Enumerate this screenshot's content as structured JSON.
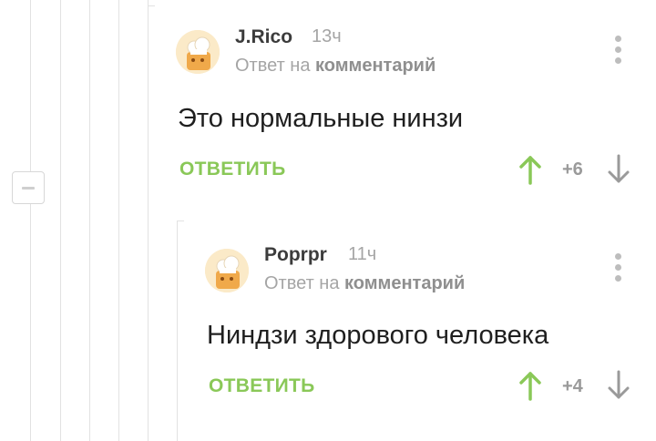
{
  "colors": {
    "accent": "#8ac858",
    "guide_line": "#e2e2e2",
    "muted_text": "#a5a5a5",
    "text": "#1f1f1f"
  },
  "thread": {
    "collapse_icon": "minus-icon"
  },
  "comments": [
    {
      "author": "J.Rico",
      "time": "13ч",
      "reply_to_prefix": "Ответ на",
      "reply_to_link": "комментарий",
      "text": "Это нормальные нинзи",
      "reply_label": "ОТВЕТИТЬ",
      "rating": "+6",
      "upvote_icon": "arrow-up-icon",
      "downvote_icon": "arrow-down-icon",
      "menu_icon": "more-vertical-icon"
    },
    {
      "author": "Poprpr",
      "time": "11ч",
      "reply_to_prefix": "Ответ на",
      "reply_to_link": "комментарий",
      "text": "Ниндзи здорового человека",
      "reply_label": "ОТВЕТИТЬ",
      "rating": "+4",
      "upvote_icon": "arrow-up-icon",
      "downvote_icon": "arrow-down-icon",
      "menu_icon": "more-vertical-icon"
    }
  ]
}
